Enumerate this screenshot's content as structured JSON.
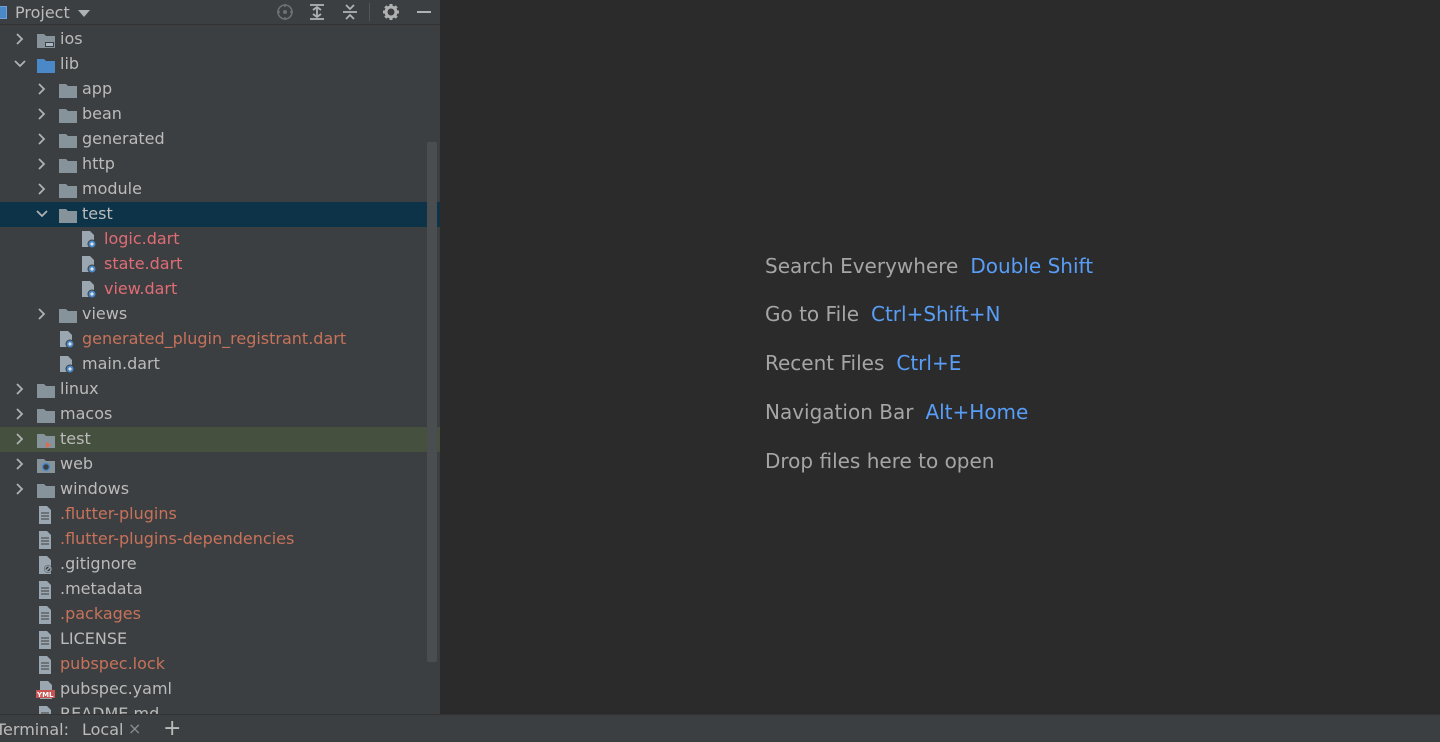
{
  "header": {
    "title": "Project"
  },
  "tree": [
    {
      "label": "ios",
      "depth": 0,
      "expanded": false,
      "icon": "folder-ios-icon",
      "color": "normal"
    },
    {
      "label": "lib",
      "depth": 0,
      "expanded": true,
      "icon": "folder-source-icon",
      "color": "normal"
    },
    {
      "label": "app",
      "depth": 1,
      "expanded": false,
      "icon": "folder-icon",
      "color": "normal"
    },
    {
      "label": "bean",
      "depth": 1,
      "expanded": false,
      "icon": "folder-icon",
      "color": "normal"
    },
    {
      "label": "generated",
      "depth": 1,
      "expanded": false,
      "icon": "folder-icon",
      "color": "normal"
    },
    {
      "label": "http",
      "depth": 1,
      "expanded": false,
      "icon": "folder-icon",
      "color": "normal"
    },
    {
      "label": "module",
      "depth": 1,
      "expanded": false,
      "icon": "folder-icon",
      "color": "normal"
    },
    {
      "label": "test",
      "depth": 1,
      "expanded": true,
      "icon": "folder-icon",
      "color": "normal",
      "state": "selected"
    },
    {
      "label": "logic.dart",
      "depth": 2,
      "icon": "dart-file-icon",
      "color": "red"
    },
    {
      "label": "state.dart",
      "depth": 2,
      "icon": "dart-file-icon",
      "color": "red"
    },
    {
      "label": "view.dart",
      "depth": 2,
      "icon": "dart-file-icon",
      "color": "red"
    },
    {
      "label": "views",
      "depth": 1,
      "expanded": false,
      "icon": "folder-icon",
      "color": "normal"
    },
    {
      "label": "generated_plugin_registrant.dart",
      "depth": 1,
      "icon": "dart-file-icon",
      "color": "orange"
    },
    {
      "label": "main.dart",
      "depth": 1,
      "icon": "dart-file-icon",
      "color": "normal"
    },
    {
      "label": "linux",
      "depth": 0,
      "expanded": false,
      "icon": "folder-icon",
      "color": "normal"
    },
    {
      "label": "macos",
      "depth": 0,
      "expanded": false,
      "icon": "folder-icon",
      "color": "normal"
    },
    {
      "label": "test",
      "depth": 0,
      "expanded": false,
      "icon": "folder-test-icon",
      "color": "normal",
      "state": "highlight"
    },
    {
      "label": "web",
      "depth": 0,
      "expanded": false,
      "icon": "folder-web-icon",
      "color": "normal"
    },
    {
      "label": "windows",
      "depth": 0,
      "expanded": false,
      "icon": "folder-icon",
      "color": "normal"
    },
    {
      "label": ".flutter-plugins",
      "depth": 0,
      "icon": "text-file-icon",
      "color": "orange"
    },
    {
      "label": ".flutter-plugins-dependencies",
      "depth": 0,
      "icon": "text-file-icon",
      "color": "orange"
    },
    {
      "label": ".gitignore",
      "depth": 0,
      "icon": "gitignore-file-icon",
      "color": "normal"
    },
    {
      "label": ".metadata",
      "depth": 0,
      "icon": "text-file-icon",
      "color": "normal"
    },
    {
      "label": ".packages",
      "depth": 0,
      "icon": "text-file-icon",
      "color": "orange"
    },
    {
      "label": "LICENSE",
      "depth": 0,
      "icon": "text-file-icon",
      "color": "normal"
    },
    {
      "label": "pubspec.lock",
      "depth": 0,
      "icon": "text-file-icon",
      "color": "orange"
    },
    {
      "label": "pubspec.yaml",
      "depth": 0,
      "icon": "yaml-file-icon",
      "color": "normal"
    },
    {
      "label": "README.md",
      "depth": 0,
      "icon": "text-file-icon",
      "color": "normal"
    }
  ],
  "editor": {
    "hints": [
      {
        "label": "Search Everywhere",
        "key": "Double Shift"
      },
      {
        "label": "Go to File",
        "key": "Ctrl+Shift+N"
      },
      {
        "label": "Recent Files",
        "key": "Ctrl+E"
      },
      {
        "label": "Navigation Bar",
        "key": "Alt+Home"
      },
      {
        "label": "Drop files here to open",
        "key": ""
      }
    ]
  },
  "terminal": {
    "label": "Terminal:",
    "tab": "Local"
  },
  "colors": {
    "accent": "#589df6",
    "selected_row": "#0d3349",
    "highlight_row": "#45503f",
    "vcs_modified": "#c7725a",
    "vcs_new": "#e06c75"
  }
}
